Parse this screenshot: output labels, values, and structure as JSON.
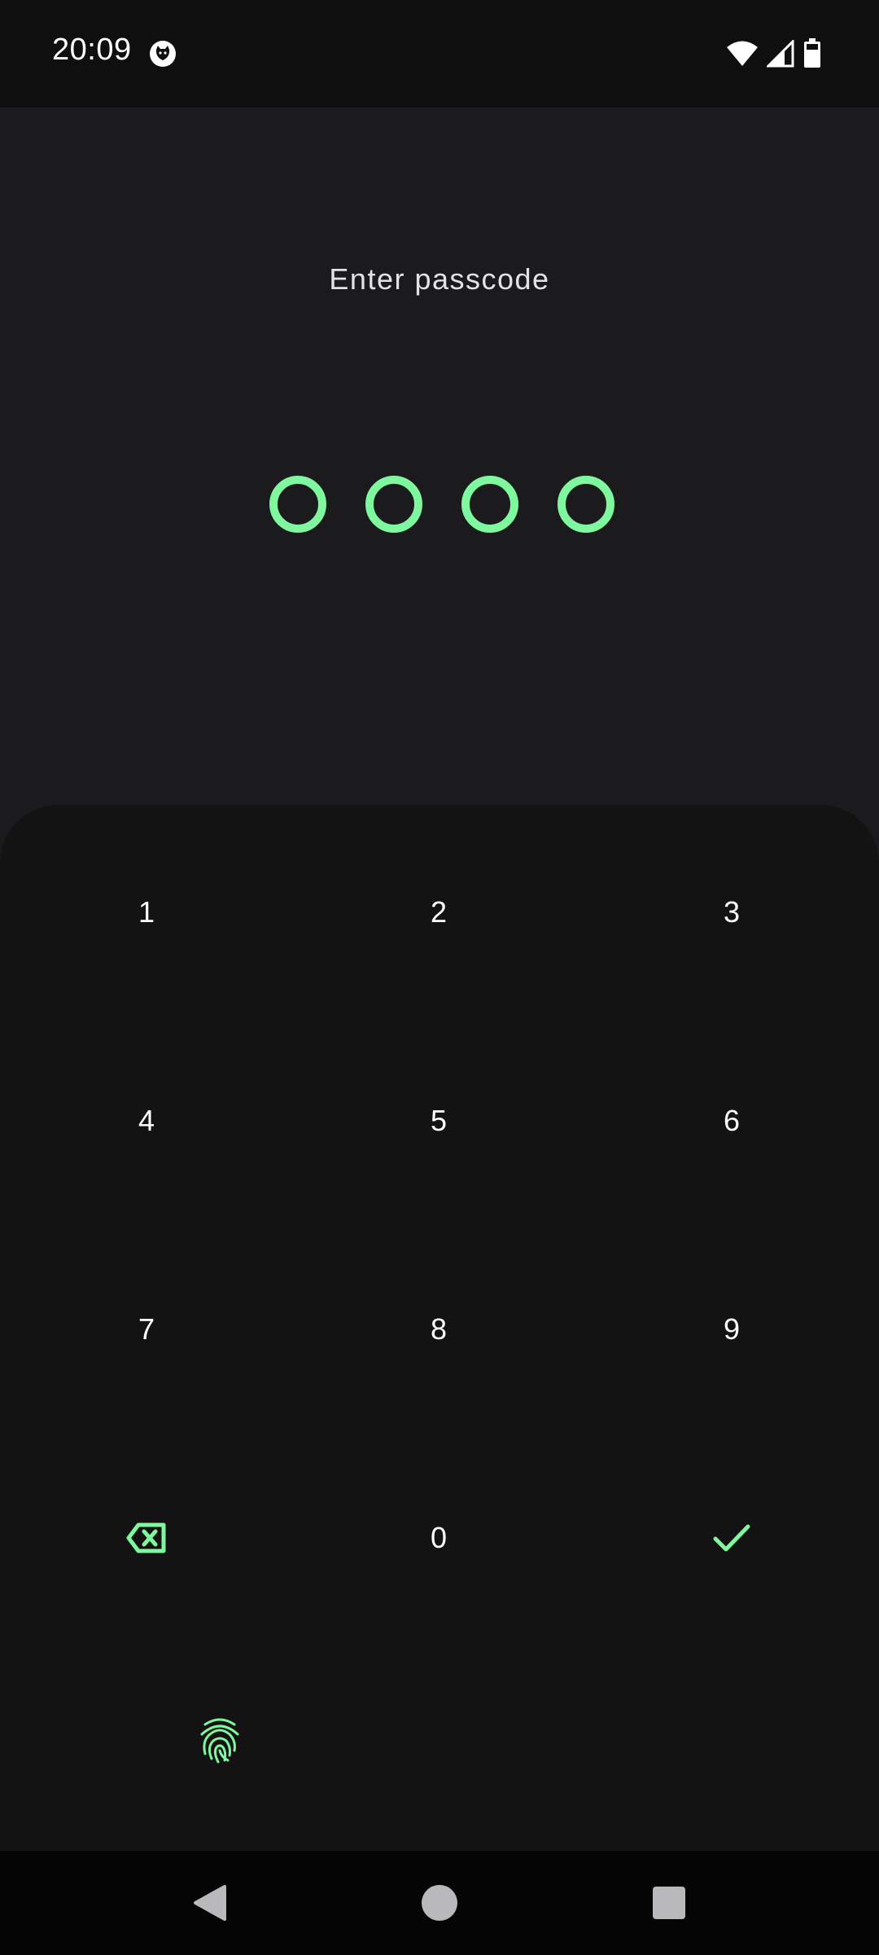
{
  "status_bar": {
    "time": "20:09",
    "icons": [
      "cat-notification-icon",
      "wifi-icon",
      "cellular-signal-icon",
      "battery-icon"
    ]
  },
  "title": "Enter passcode",
  "pin": {
    "length": 4,
    "entered": 0
  },
  "keypad": {
    "keys": [
      {
        "label": "1"
      },
      {
        "label": "2"
      },
      {
        "label": "3"
      },
      {
        "label": "4"
      },
      {
        "label": "5"
      },
      {
        "label": "6"
      },
      {
        "label": "7"
      },
      {
        "label": "8"
      },
      {
        "label": "9"
      },
      {
        "label": ""
      },
      {
        "label": "0"
      },
      {
        "label": ""
      }
    ],
    "backspace_icon": "backspace-icon",
    "confirm_icon": "checkmark-icon",
    "fingerprint_icon": "fingerprint-icon"
  },
  "nav_bar": {
    "icons": [
      "back-icon",
      "home-icon",
      "recents-icon"
    ]
  },
  "colors": {
    "background": "#1b1a1c",
    "keypad_background": "#141314",
    "accent": "#7ef79f",
    "text": "#ffffff",
    "title_text": "#e4e2e6"
  }
}
